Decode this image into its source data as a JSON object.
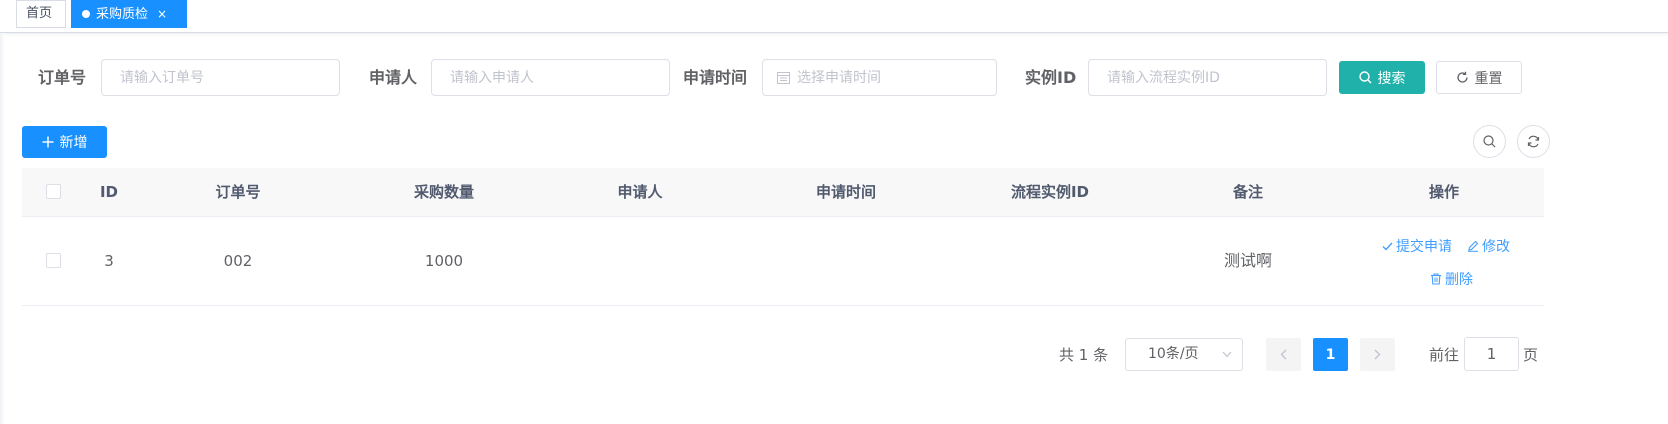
{
  "tabs": {
    "home": "首页",
    "active": "采购质检",
    "close": "×"
  },
  "search_form": {
    "order_no_label": "订单号",
    "order_no_placeholder": "请输入订单号",
    "applicant_label": "申请人",
    "applicant_placeholder": "请输入申请人",
    "apply_time_label": "申请时间",
    "apply_time_placeholder": "选择申请时间",
    "instance_id_label": "实例ID",
    "instance_id_placeholder": "请输入流程实例ID",
    "search_button": "搜索",
    "reset_button": "重置"
  },
  "toolbar": {
    "add_button": "新增"
  },
  "table": {
    "headers": {
      "id": "ID",
      "order_no": "订单号",
      "quantity": "采购数量",
      "applicant": "申请人",
      "apply_time": "申请时间",
      "instance_id": "流程实例ID",
      "remark": "备注",
      "actions": "操作"
    },
    "rows": [
      {
        "id": "3",
        "order_no": "002",
        "quantity": "1000",
        "applicant": "",
        "apply_time": "",
        "instance_id": "",
        "remark": "测试啊",
        "action_submit": "提交申请",
        "action_edit": "修改",
        "action_delete": "删除"
      }
    ]
  },
  "pagination": {
    "total": "共 1 条",
    "page_size": "10条/页",
    "current_page": "1",
    "goto_label": "前往",
    "goto_value": "1",
    "goto_unit": "页"
  },
  "colors": {
    "primary": "#1890ff",
    "search_button": "#20b2aa",
    "link": "#409eff"
  }
}
